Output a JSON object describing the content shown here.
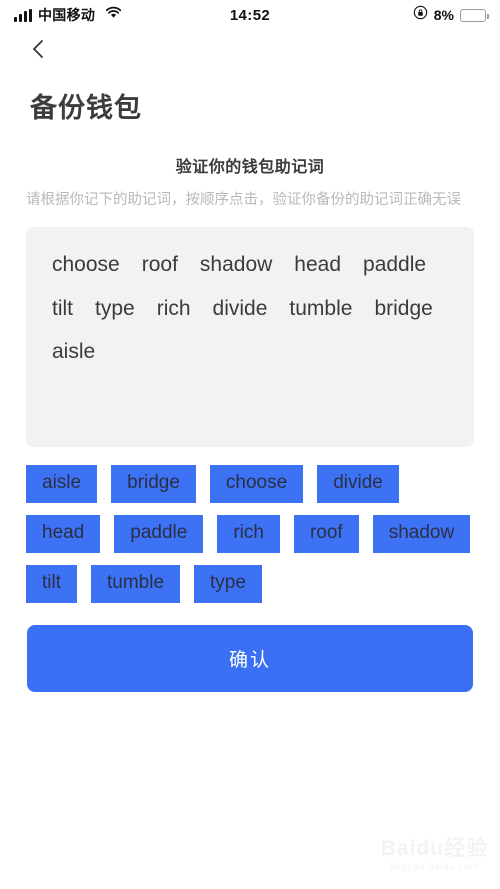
{
  "status_bar": {
    "carrier": "中国移动",
    "time": "14:52",
    "battery_percent": "8%",
    "battery_level": 8,
    "signal_icon": "signal-bars-icon",
    "wifi_icon": "wifi-icon",
    "rotation_lock_icon": "rotation-lock-icon",
    "battery_icon": "battery-icon",
    "battery_color": "#f5342a"
  },
  "nav": {
    "back_icon": "chevron-left-icon",
    "title": "备份钱包"
  },
  "instructions": {
    "heading": "验证你的钱包助记词",
    "subtitle": "请根据你记下的助记词，按顺序点击，验证你备份的助记词正确无误"
  },
  "selected_panel": {
    "words": [
      "choose",
      "roof",
      "shadow",
      "head",
      "paddle",
      "tilt",
      "type",
      "rich",
      "divide",
      "tumble",
      "bridge",
      "aisle"
    ]
  },
  "word_chips": {
    "chip_color": "#3d72f5",
    "chips": [
      "aisle",
      "bridge",
      "choose",
      "divide",
      "head",
      "paddle",
      "rich",
      "roof",
      "shadow",
      "tilt",
      "tumble",
      "type"
    ]
  },
  "confirm": {
    "label": "确认",
    "color": "#3b70f5"
  },
  "watermark": {
    "main": "Baidu经验",
    "sub": "jingyan.baidu.com"
  }
}
